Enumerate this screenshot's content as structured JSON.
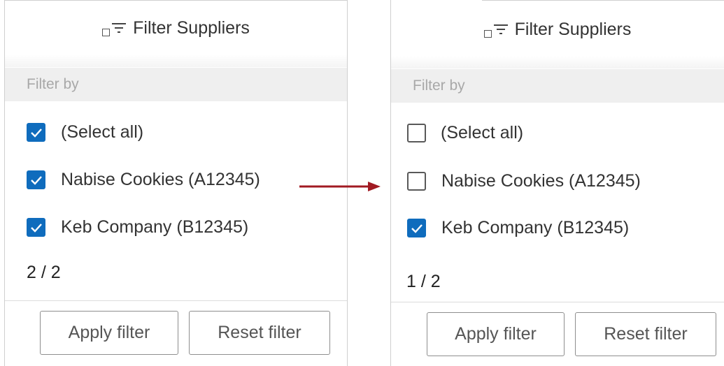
{
  "colors": {
    "accent": "#0f6cbd",
    "arrow": "#a11a22",
    "filter_bar_bg": "#efefef"
  },
  "panels": [
    {
      "title": "Filter Suppliers",
      "filter_by": "Filter by",
      "options": [
        {
          "label": "(Select all)",
          "checked": true
        },
        {
          "label": "Nabise Cookies (A12345)",
          "checked": true
        },
        {
          "label": "Keb Company (B12345)",
          "checked": true
        }
      ],
      "count": "2 / 2",
      "apply_label": "Apply filter",
      "reset_label": "Reset filter"
    },
    {
      "title": "Filter Suppliers",
      "filter_by": "Filter by",
      "options": [
        {
          "label": "(Select all)",
          "checked": false
        },
        {
          "label": "Nabise Cookies (A12345)",
          "checked": false
        },
        {
          "label": "Keb Company (B12345)",
          "checked": true
        }
      ],
      "count": "1 / 2",
      "apply_label": "Apply filter",
      "reset_label": "Reset filter"
    }
  ],
  "icons": {
    "header": "filter-icon",
    "header_square": "checkbox-outline-icon",
    "arrow": "arrow-right-icon",
    "check": "checkmark-icon"
  }
}
